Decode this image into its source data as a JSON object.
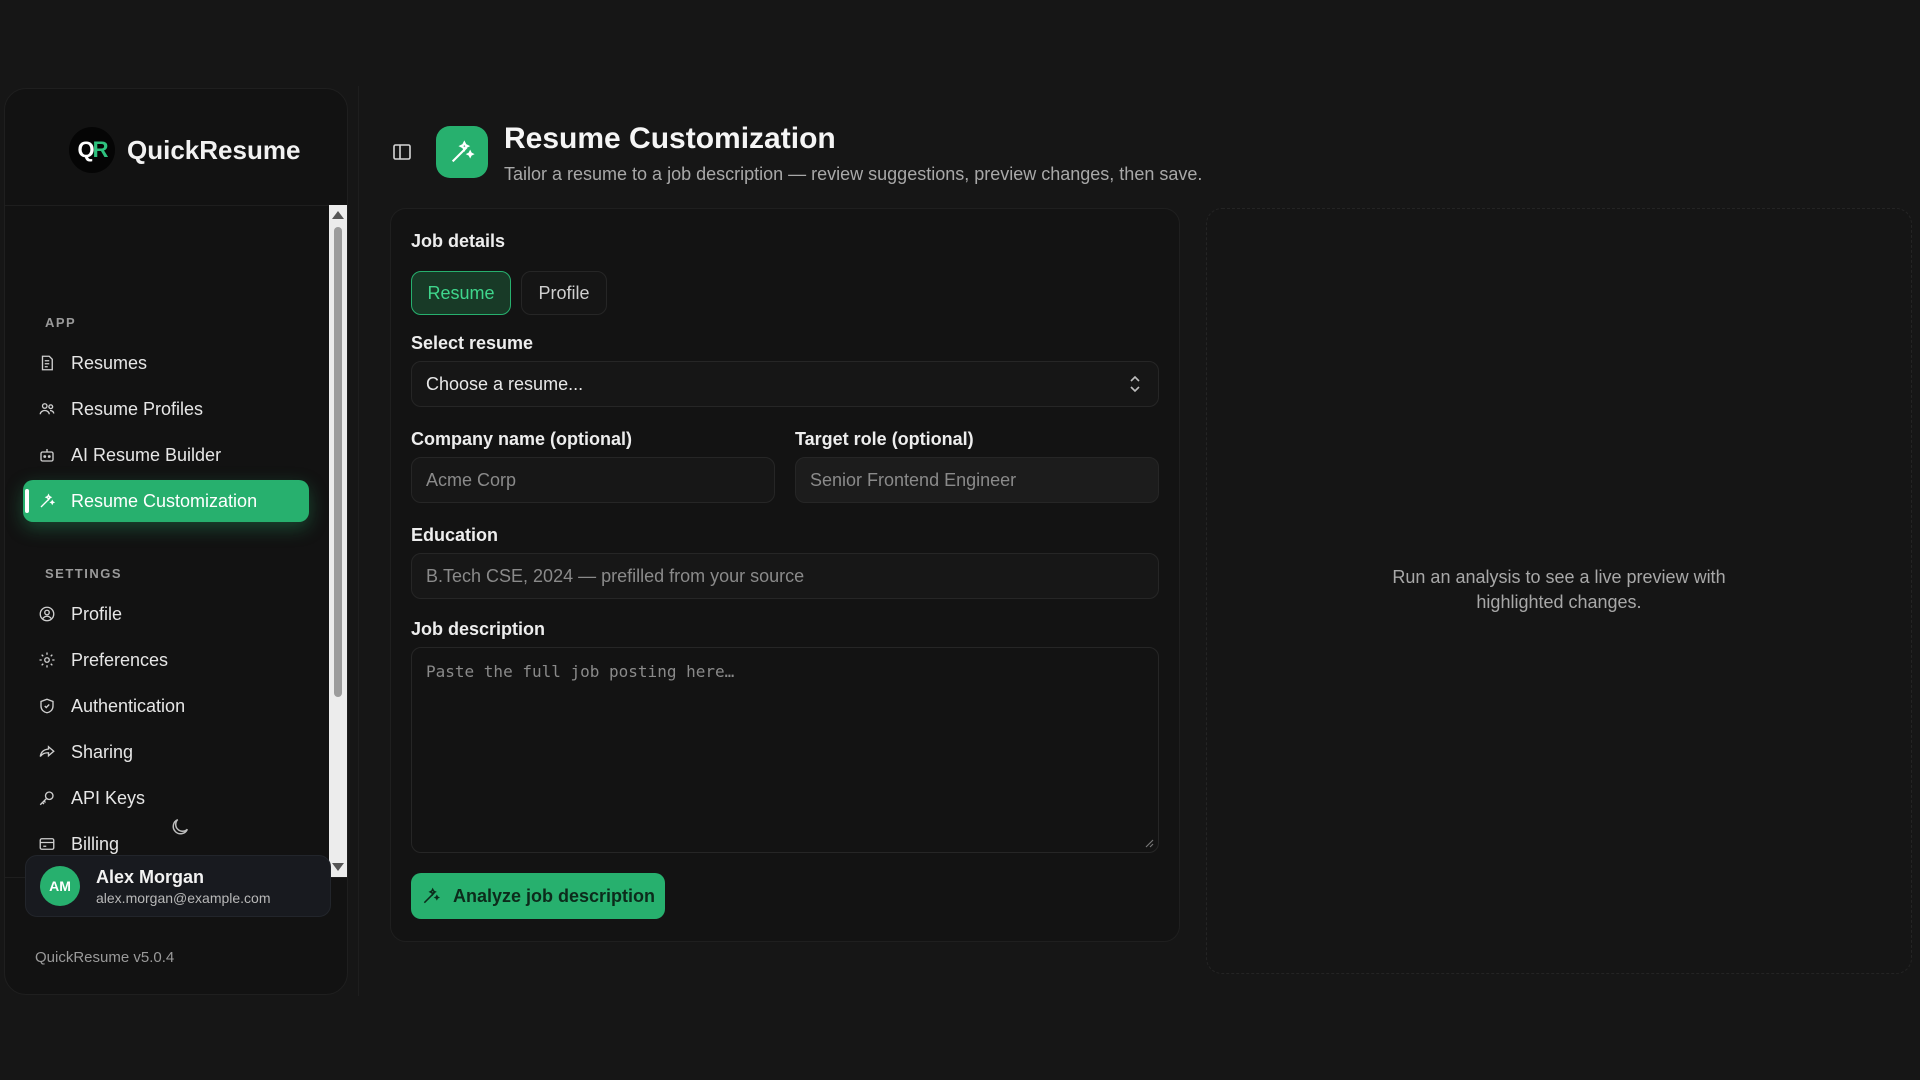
{
  "app": {
    "brand_name": "QuickResume",
    "logo_text_a": "Q",
    "logo_text_b": "R",
    "version": "QuickResume v5.0.4"
  },
  "sidebar": {
    "sections": [
      {
        "label": "APP",
        "items": [
          {
            "label": "Resumes",
            "icon": "file-icon",
            "active": false
          },
          {
            "label": "Resume Profiles",
            "icon": "users-icon",
            "active": false
          },
          {
            "label": "AI Resume Builder",
            "icon": "bot-icon",
            "active": false
          },
          {
            "label": "Resume Customization",
            "icon": "wand-icon",
            "active": true
          }
        ]
      },
      {
        "label": "SETTINGS",
        "items": [
          {
            "label": "Profile",
            "icon": "user-circle-icon",
            "active": false
          },
          {
            "label": "Preferences",
            "icon": "gear-icon",
            "active": false
          },
          {
            "label": "Authentication",
            "icon": "shield-icon",
            "active": false
          },
          {
            "label": "Sharing",
            "icon": "share-icon",
            "active": false
          },
          {
            "label": "API Keys",
            "icon": "key-icon",
            "active": false
          },
          {
            "label": "Billing",
            "icon": "credit-card-icon",
            "active": false
          }
        ]
      }
    ],
    "theme_toggle_icon": "moon-icon",
    "user": {
      "initials": "AM",
      "name": "Alex Morgan",
      "email": "alex.morgan@example.com"
    }
  },
  "header": {
    "title": "Resume Customization",
    "subtitle": "Tailor a resume to a job description — review suggestions, preview changes, then save.",
    "icon": "wand-icon"
  },
  "form": {
    "section_title": "Job details",
    "source_tabs": [
      {
        "label": "Resume",
        "selected": true
      },
      {
        "label": "Profile",
        "selected": false
      }
    ],
    "select_resume": {
      "label": "Select resume",
      "value": "Choose a resume..."
    },
    "company": {
      "label": "Company name (optional)",
      "placeholder": "Acme Corp"
    },
    "role": {
      "label": "Target role (optional)",
      "placeholder": "Senior Frontend Engineer"
    },
    "education": {
      "label": "Education",
      "placeholder": "B.Tech CSE, 2024 — prefilled from your source"
    },
    "job_description": {
      "label": "Job description",
      "placeholder": "Paste the full job posting here…"
    },
    "analyze_button": "Analyze job description"
  },
  "preview": {
    "empty_message": "Run an analysis to see a live preview with highlighted changes."
  },
  "colors": {
    "accent": "#27b06e",
    "background": "#161616"
  }
}
